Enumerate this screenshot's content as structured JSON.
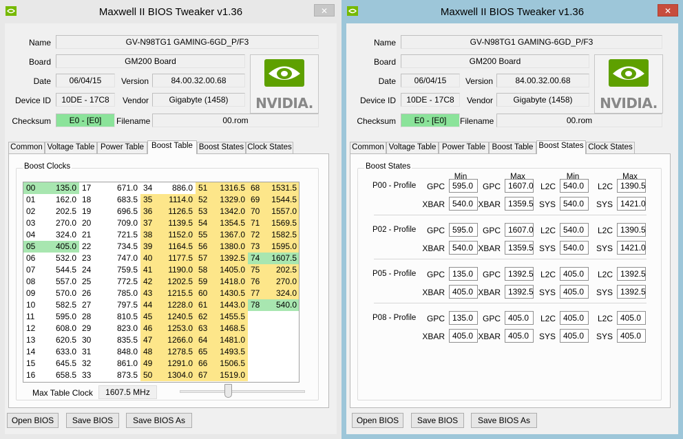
{
  "windows": [
    {
      "title": "Maxwell II BIOS Tweaker v1.36",
      "close": "✕"
    },
    {
      "title": "Maxwell II BIOS Tweaker v1.36",
      "close": "✕"
    }
  ],
  "info": {
    "name_label": "Name",
    "name": "GV-N98TG1 GAMING-6GD_P/F3",
    "board_label": "Board",
    "board": "GM200 Board",
    "date_label": "Date",
    "date": "06/04/15",
    "version_label": "Version",
    "version": "84.00.32.00.68",
    "device_label": "Device ID",
    "device": "10DE - 17C8",
    "vendor_label": "Vendor",
    "vendor": "Gigabyte (1458)",
    "checksum_label": "Checksum",
    "checksum": "E0 - [E0]",
    "filename_label": "Filename",
    "filename": "00.rom",
    "logo_text": "NVIDIA."
  },
  "tabs": [
    "Common",
    "Voltage Table",
    "Power Table",
    "Boost Table",
    "Boost States",
    "Clock States"
  ],
  "boost_table": {
    "group_label": "Boost Clocks",
    "rows": [
      [
        "00",
        "135.0",
        "17",
        "671.0",
        "34",
        "886.0",
        "51",
        "1316.5",
        "68",
        "1531.5"
      ],
      [
        "01",
        "162.0",
        "18",
        "683.5",
        "35",
        "1114.0",
        "52",
        "1329.0",
        "69",
        "1544.5"
      ],
      [
        "02",
        "202.5",
        "19",
        "696.5",
        "36",
        "1126.5",
        "53",
        "1342.0",
        "70",
        "1557.0"
      ],
      [
        "03",
        "270.0",
        "20",
        "709.0",
        "37",
        "1139.5",
        "54",
        "1354.5",
        "71",
        "1569.5"
      ],
      [
        "04",
        "324.0",
        "21",
        "721.5",
        "38",
        "1152.0",
        "55",
        "1367.0",
        "72",
        "1582.5"
      ],
      [
        "05",
        "405.0",
        "22",
        "734.5",
        "39",
        "1164.5",
        "56",
        "1380.0",
        "73",
        "1595.0"
      ],
      [
        "06",
        "532.0",
        "23",
        "747.0",
        "40",
        "1177.5",
        "57",
        "1392.5",
        "74",
        "1607.5"
      ],
      [
        "07",
        "544.5",
        "24",
        "759.5",
        "41",
        "1190.0",
        "58",
        "1405.0",
        "75",
        "202.5"
      ],
      [
        "08",
        "557.0",
        "25",
        "772.5",
        "42",
        "1202.5",
        "59",
        "1418.0",
        "76",
        "270.0"
      ],
      [
        "09",
        "570.0",
        "26",
        "785.0",
        "43",
        "1215.5",
        "60",
        "1430.5",
        "77",
        "324.0"
      ],
      [
        "10",
        "582.5",
        "27",
        "797.5",
        "44",
        "1228.0",
        "61",
        "1443.0",
        "78",
        "540.0"
      ],
      [
        "11",
        "595.0",
        "28",
        "810.5",
        "45",
        "1240.5",
        "62",
        "1455.5",
        "",
        ""
      ],
      [
        "12",
        "608.0",
        "29",
        "823.0",
        "46",
        "1253.0",
        "63",
        "1468.5",
        "",
        ""
      ],
      [
        "13",
        "620.5",
        "30",
        "835.5",
        "47",
        "1266.0",
        "64",
        "1481.0",
        "",
        ""
      ],
      [
        "14",
        "633.0",
        "31",
        "848.0",
        "48",
        "1278.5",
        "65",
        "1493.5",
        "",
        ""
      ],
      [
        "15",
        "645.5",
        "32",
        "861.0",
        "49",
        "1291.0",
        "66",
        "1506.5",
        "",
        ""
      ],
      [
        "16",
        "658.5",
        "33",
        "873.5",
        "50",
        "1304.0",
        "67",
        "1519.0",
        "",
        ""
      ]
    ],
    "max_label": "Max Table Clock",
    "max_value": "1607.5 MHz",
    "slider_value": 0.38
  },
  "boost_states": {
    "group_label": "Boost States",
    "headers": [
      "Min",
      "Max",
      "Min",
      "Max"
    ],
    "profiles": [
      {
        "name": "P00 - Profile",
        "gpc_min": "595.0",
        "gpc_max": "1607.0",
        "l2c_min": "540.0",
        "l2c_max": "1390.5",
        "xbar_min": "540.0",
        "xbar_max": "1359.5",
        "sys_min": "540.0",
        "sys_max": "1421.0"
      },
      {
        "name": "P02 - Profile",
        "gpc_min": "595.0",
        "gpc_max": "1607.0",
        "l2c_min": "540.0",
        "l2c_max": "1390.5",
        "xbar_min": "540.0",
        "xbar_max": "1359.5",
        "sys_min": "540.0",
        "sys_max": "1421.0"
      },
      {
        "name": "P05 - Profile",
        "gpc_min": "135.0",
        "gpc_max": "1392.5",
        "l2c_min": "405.0",
        "l2c_max": "1392.5",
        "xbar_min": "405.0",
        "xbar_max": "1392.5",
        "sys_min": "405.0",
        "sys_max": "1392.5"
      },
      {
        "name": "P08 - Profile",
        "gpc_min": "135.0",
        "gpc_max": "405.0",
        "l2c_min": "405.0",
        "l2c_max": "405.0",
        "xbar_min": "405.0",
        "xbar_max": "405.0",
        "sys_min": "405.0",
        "sys_max": "405.0"
      }
    ],
    "labels": {
      "gpc": "GPC",
      "xbar": "XBAR",
      "l2c": "L2C",
      "sys": "SYS"
    }
  },
  "buttons": {
    "open": "Open BIOS",
    "save": "Save BIOS",
    "save_as": "Save BIOS As"
  },
  "colors": {
    "left_frame": "#e8e8e8",
    "right_frame": "#9dc6d9",
    "checksum_ok": "#8be39a",
    "boost_highlight": "#fde68a",
    "green_highlight": "#a8e6b0"
  }
}
